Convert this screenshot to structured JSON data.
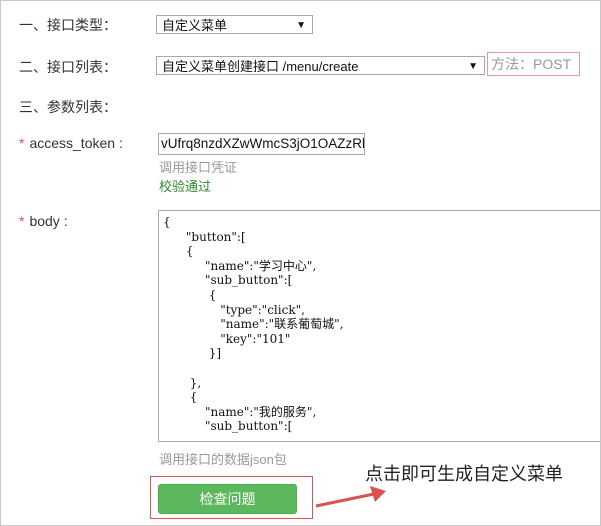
{
  "form": {
    "interface_type_label": "一、接口类型：",
    "interface_type_value": "自定义菜单",
    "interface_list_label": "二、接口列表：",
    "interface_list_value": "自定义菜单创建接口 /menu/create",
    "method_text": "方法：POST",
    "params_label": "三、参数列表：",
    "access_token": {
      "required_mark": "*",
      "label": "access_token :",
      "value": "vUfrq8nzdXZwWmcS3jO1OAZzRl",
      "hint": "调用接口凭证",
      "status": "校验通过"
    },
    "body": {
      "required_mark": "*",
      "label": "body :",
      "content": "{\n      \"button\":[\n      {\n           \"name\":\"学习中心\",\n           \"sub_button\":[\n            {\n               \"type\":\"click\",\n               \"name\":\"联系葡萄城\",\n               \"key\":\"101\"\n            }]\n\n       },\n       {\n           \"name\":\"我的服务\",\n           \"sub_button\":[",
      "hint": "调用接口的数据json包"
    },
    "submit_label": "检查问题"
  },
  "annotation": {
    "text": "点击即可生成自定义菜单"
  },
  "icons": {
    "dropdown": "chevron-down-icon",
    "pointer": "arrow-left-icon"
  },
  "colors": {
    "button_green": "#5cb85c",
    "success_text": "#2e8b2e",
    "required": "#d9534f",
    "highlight_border": "#d9534f"
  }
}
